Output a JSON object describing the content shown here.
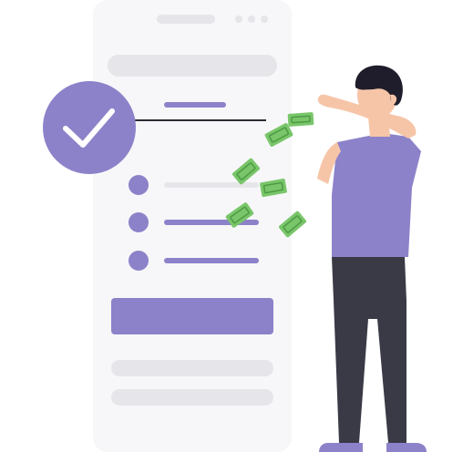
{
  "colors": {
    "card": "#f7f7f9",
    "placeholder": "#e6e6ea",
    "accent": "#8c82c9",
    "accent_dark": "#7a70b8",
    "money": "#79c66a",
    "money_dark": "#4e9a44",
    "skin": "#f6c5a8",
    "hair": "#1f1d2b",
    "pants": "#3a3a47",
    "shoes": "#8c82c9",
    "line": "#2b2b35",
    "white": "#ffffff"
  },
  "icons": {
    "status": "check-icon",
    "item": "radio-dot-icon",
    "cash": "banknote-icon"
  },
  "checklist": {
    "items_checked": [
      false,
      true,
      true
    ]
  }
}
